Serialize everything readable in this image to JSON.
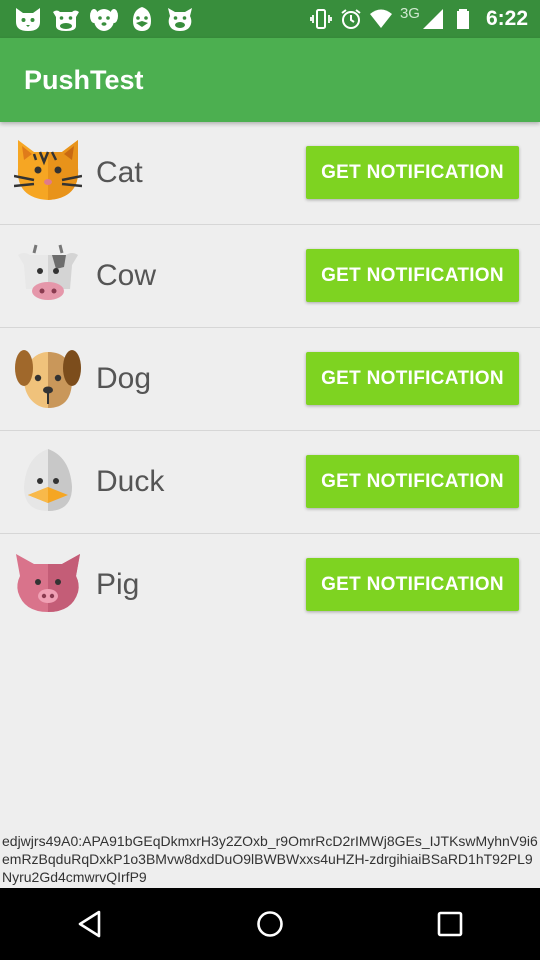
{
  "status_bar": {
    "time": "6:22",
    "network_type": "3G",
    "notification_icons": [
      "cat-face-icon",
      "cow-face-icon",
      "dog-face-icon",
      "duck-face-icon",
      "pig-face-icon"
    ],
    "system_icons": [
      "vibrate-icon",
      "alarm-icon",
      "wifi-icon",
      "signal-icon",
      "battery-icon"
    ]
  },
  "app_bar": {
    "title": "PushTest"
  },
  "animals": [
    {
      "name": "Cat",
      "button_label": "GET NOTIFICATION",
      "icon": "cat-icon"
    },
    {
      "name": "Cow",
      "button_label": "GET NOTIFICATION",
      "icon": "cow-icon"
    },
    {
      "name": "Dog",
      "button_label": "GET NOTIFICATION",
      "icon": "dog-icon"
    },
    {
      "name": "Duck",
      "button_label": "GET NOTIFICATION",
      "icon": "duck-icon"
    },
    {
      "name": "Pig",
      "button_label": "GET NOTIFICATION",
      "icon": "pig-icon"
    }
  ],
  "token": "edjwjrs49A0:APA91bGEqDkmxrH3y2ZOxb_r9OmrRcD2rIMWj8GEs_IJTKswMyhnV9i6emRzBqduRqDxkP1o3BMvw8dxdDuO9lBWBWxxs4uHZH-zdrgihiaiBSaRD1hT92PL9Nyru2Gd4cmwrvQIrfP9",
  "nav_bar": {
    "buttons": [
      "back-icon",
      "home-icon",
      "recents-icon"
    ]
  },
  "colors": {
    "status_bar": "#388e3c",
    "app_bar": "#4caf50",
    "button": "#7ed321",
    "background": "#eeeeee"
  }
}
